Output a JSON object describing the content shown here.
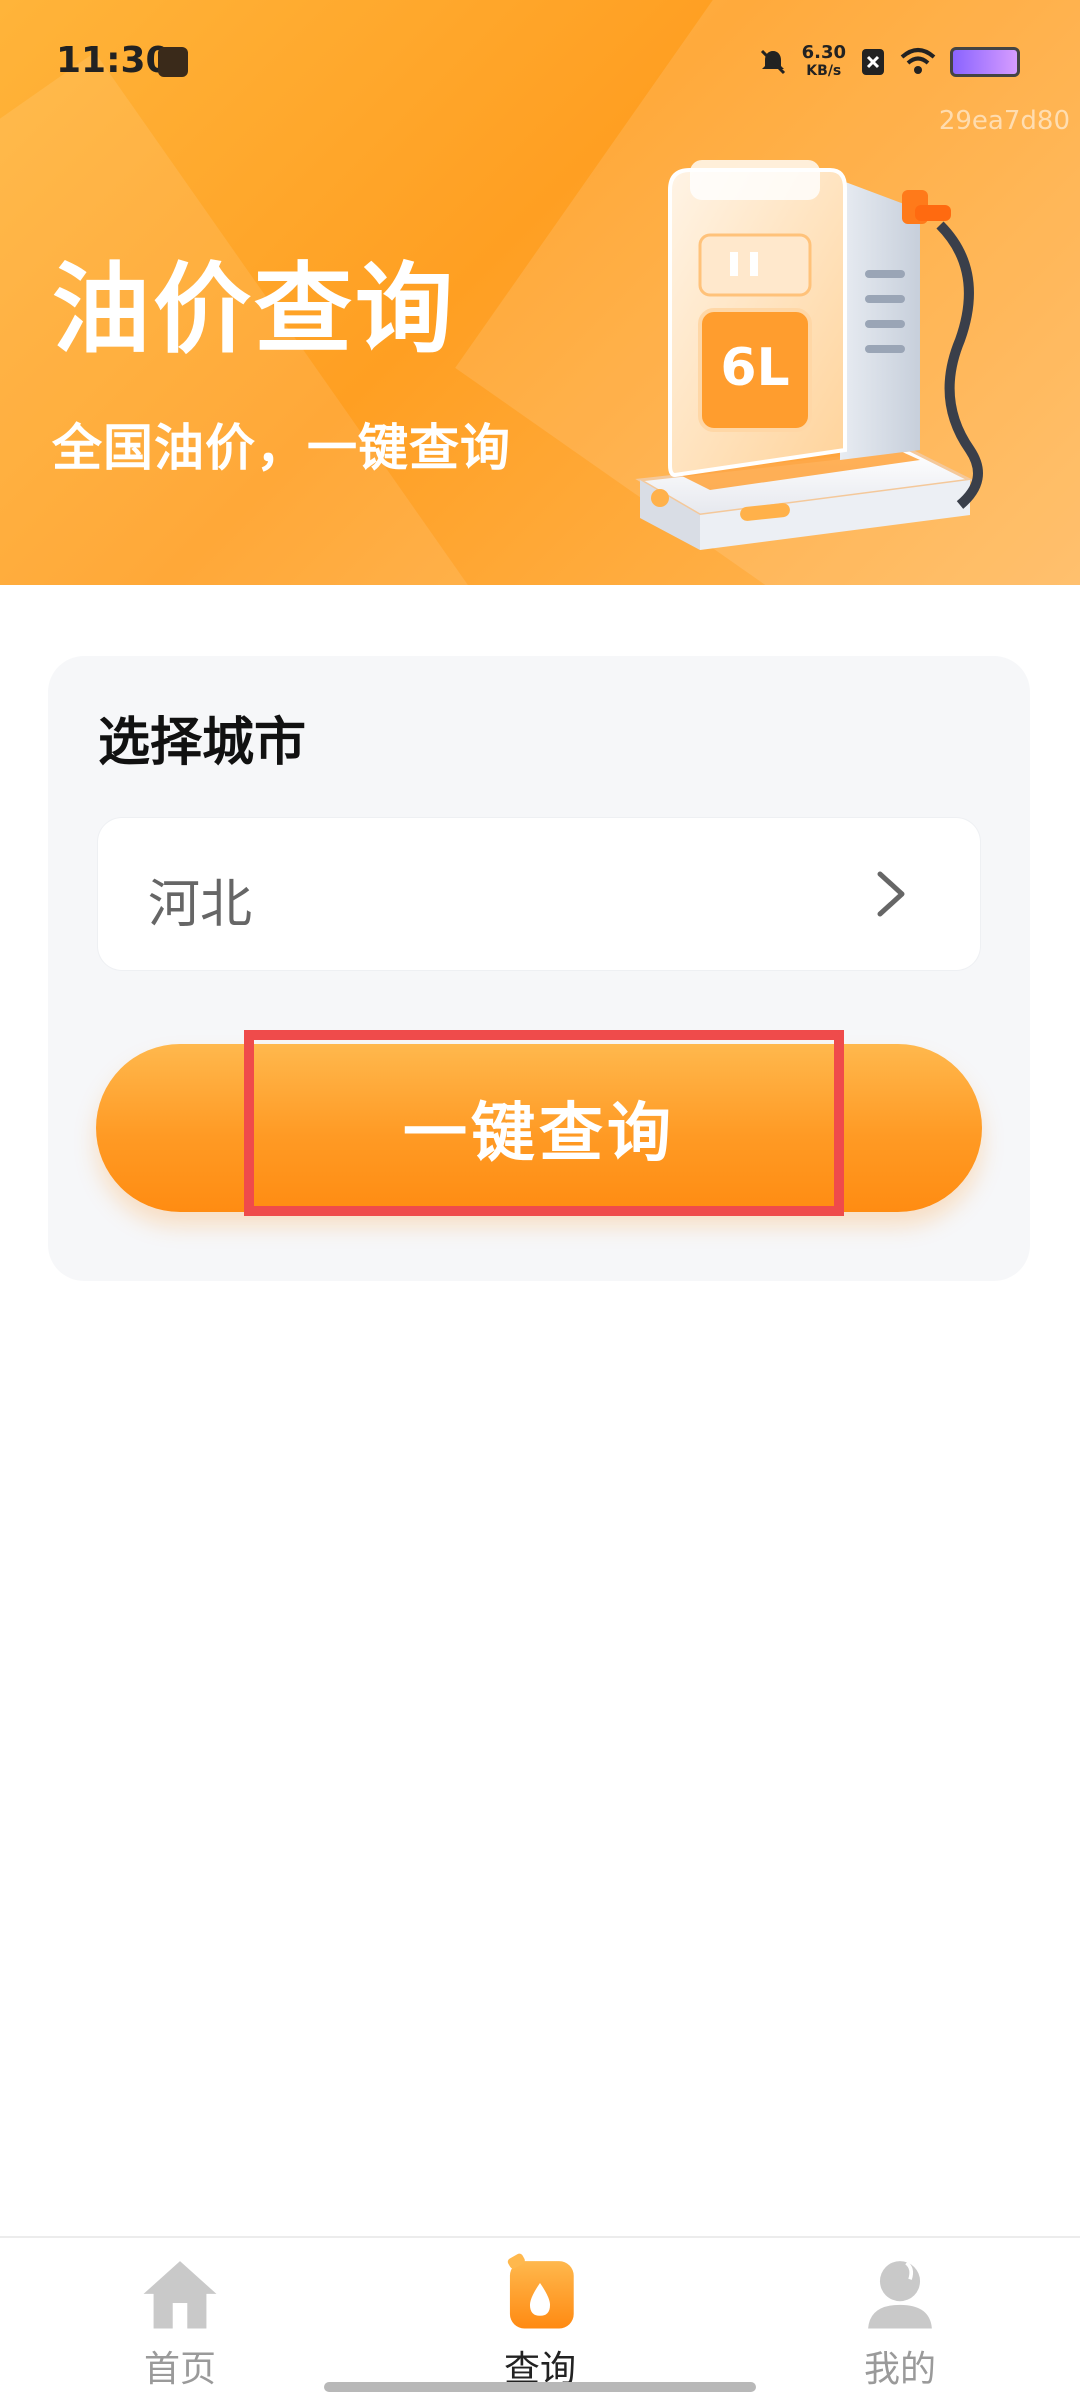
{
  "status_bar": {
    "time": "11:30",
    "net_speed": "6.30",
    "net_speed_unit": "KB/s",
    "build_id": "29ea7d80"
  },
  "banner": {
    "title": "油价查询",
    "subtitle": "全国油价，一键查询",
    "pump_display": "6L"
  },
  "card": {
    "title": "选择城市",
    "city_value": "河北",
    "query_button_label": "一键查询"
  },
  "bottom_nav": {
    "items": [
      {
        "label": "首页",
        "icon": "home-icon",
        "active": false
      },
      {
        "label": "查询",
        "icon": "fuel-drop-icon",
        "active": true
      },
      {
        "label": "我的",
        "icon": "user-icon",
        "active": false
      }
    ]
  },
  "colors": {
    "accent": "#ff9a24",
    "highlight": "#ef4b4b"
  }
}
